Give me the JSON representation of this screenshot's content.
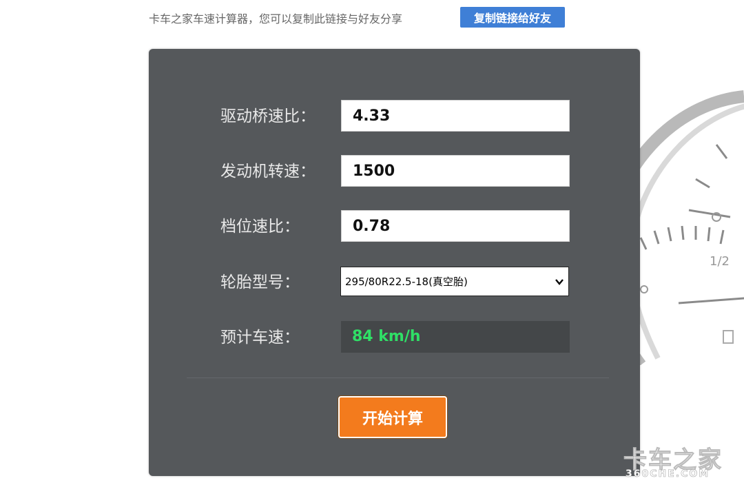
{
  "header": {
    "text": "卡车之家车速计算器，您可以复制此链接与好友分享",
    "copy_button": "复制链接给好友"
  },
  "form": {
    "axle_ratio": {
      "label": "驱动桥速比：",
      "value": "4.33"
    },
    "engine_speed": {
      "label": "发动机转速：",
      "value": "1500"
    },
    "gear_ratio": {
      "label": "档位速比：",
      "value": "0.78"
    },
    "tire": {
      "label": "轮胎型号：",
      "value": "295/80R22.5-18(真空胎)"
    },
    "speed": {
      "label": "预计车速：",
      "value": "84 km/h"
    }
  },
  "calculate_button": "开始计算",
  "watermark": {
    "brand": "卡车之家",
    "domain": "360CHE.COM"
  },
  "dial_marks": {
    "half": "1/2"
  },
  "colors": {
    "panel": "#55585b",
    "accent_orange": "#f37b1d",
    "link_blue": "#3f7fd6",
    "result_green": "#2fe066"
  }
}
